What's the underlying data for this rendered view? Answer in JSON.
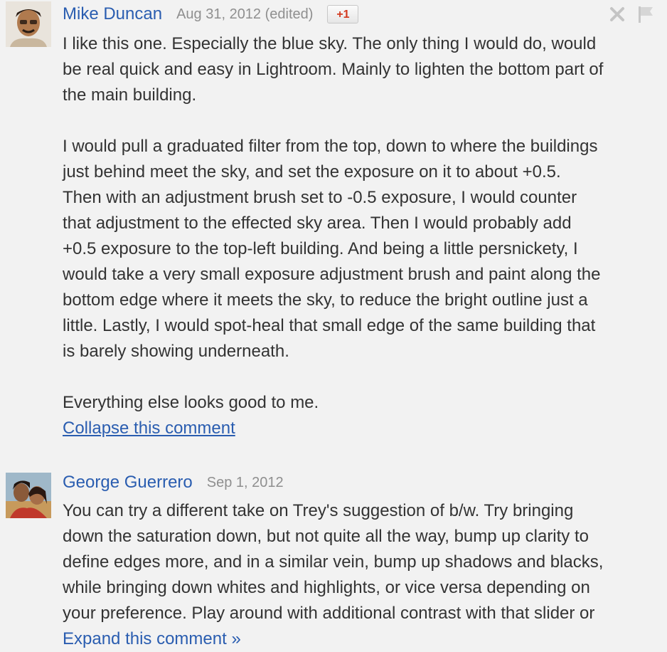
{
  "comments": [
    {
      "author": "Mike Duncan",
      "date": "Aug 31, 2012 (edited)",
      "plus_one": "+1",
      "avatar": "avatar-photo",
      "tools": {
        "close_icon": "close-icon",
        "flag_icon": "flag-icon"
      },
      "paragraphs": [
        "I like this one. Especially the blue sky. The only thing I would do, would\nbe real quick and easy in Lightroom. Mainly to lighten the bottom part of\nthe main building.",
        "I would pull a graduated filter from the top, down to where the buildings\njust behind meet the sky, and set the exposure on it to about +0.5.\nThen with an adjustment brush set to -0.5 exposure, I would counter\nthat adjustment to the effected sky area. Then I would probably add\n+0.5 exposure to the top-left building. And being a little persnickety, I\nwould take a very small exposure adjustment brush and paint along the\nbottom edge where it meets the sky, to reduce the bright outline just a\nlittle. Lastly, I would spot-heal that small edge of the same building that\nis barely showing underneath.",
        "Everything else looks good to me."
      ],
      "action_link": "Collapse this comment"
    },
    {
      "author": "George Guerrero",
      "date": "Sep 1, 2012",
      "avatar": "avatar-photo",
      "paragraphs": [
        "You can try a different take on Trey's suggestion of b/w. Try bringing\ndown the saturation down, but not quite all the way, bump up clarity to\ndefine edges more, and in a similar vein, bump up shadows and blacks,\nwhile bringing down whites and highlights, or vice versa depending on\nyour preference. Play around with additional contrast with that slider or"
      ],
      "action_link": "Expand this comment »"
    }
  ],
  "colors": {
    "background": "#f2f2f2",
    "link": "#2a5db0",
    "text": "#333333",
    "meta": "#8f8f8f",
    "plus_one": "#d3391f"
  }
}
